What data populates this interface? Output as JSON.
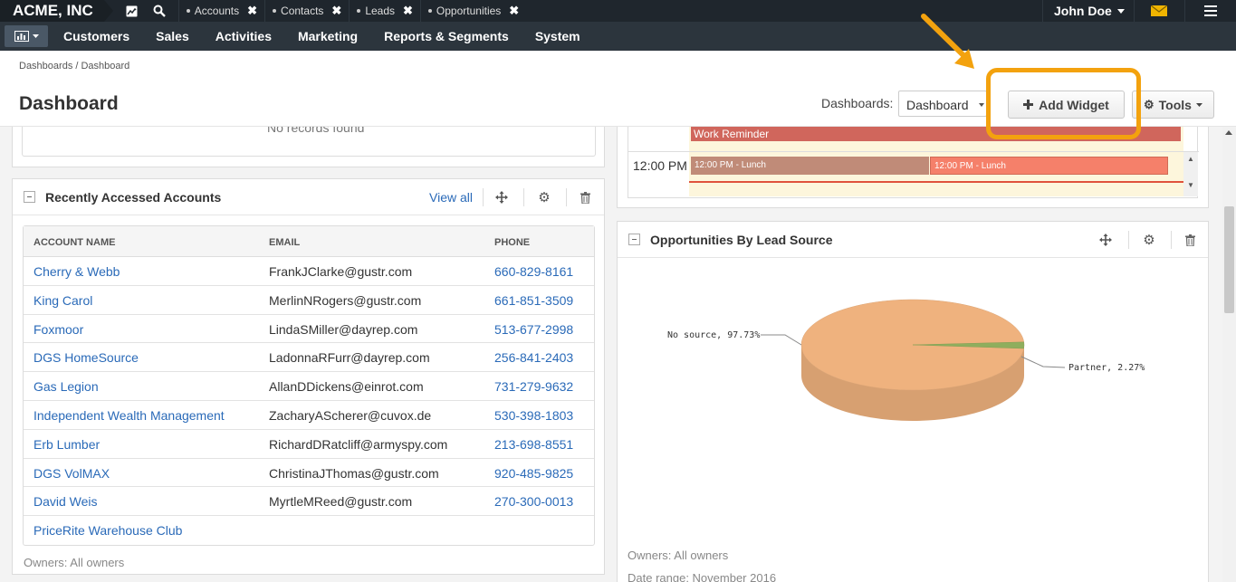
{
  "topbar": {
    "brand": "ACME, INC",
    "pinned_tabs": [
      "Accounts",
      "Contacts",
      "Leads",
      "Opportunities"
    ],
    "user": "John Doe"
  },
  "nav": {
    "items": [
      "Customers",
      "Sales",
      "Activities",
      "Marketing",
      "Reports & Segments",
      "System"
    ]
  },
  "breadcrumb": "Dashboards / Dashboard",
  "header": {
    "title": "Dashboard",
    "dashboards_label": "Dashboards:",
    "dashboard_select": "Dashboard",
    "add_widget": "Add Widget",
    "tools": "Tools"
  },
  "top_widget": {
    "no_records": "No records found"
  },
  "accounts_widget": {
    "title": "Recently Accessed Accounts",
    "view_all": "View all",
    "columns": [
      "ACCOUNT NAME",
      "EMAIL",
      "PHONE"
    ],
    "rows": [
      {
        "name": "Cherry & Webb",
        "email": "FrankJClarke@gustr.com",
        "phone": "660-829-8161"
      },
      {
        "name": "King Carol",
        "email": "MerlinNRogers@gustr.com",
        "phone": "661-851-3509"
      },
      {
        "name": "Foxmoor",
        "email": "LindaSMiller@dayrep.com",
        "phone": "513-677-2998"
      },
      {
        "name": "DGS HomeSource",
        "email": "LadonnaRFurr@dayrep.com",
        "phone": "256-841-2403"
      },
      {
        "name": "Gas Legion",
        "email": "AllanDDickens@einrot.com",
        "phone": "731-279-9632"
      },
      {
        "name": "Independent Wealth Management",
        "email": "ZacharyAScherer@cuvox.de",
        "phone": "530-398-1803"
      },
      {
        "name": "Erb Lumber",
        "email": "RichardDRatcliff@armyspy.com",
        "phone": "213-698-8551"
      },
      {
        "name": "DGS VolMAX",
        "email": "ChristinaJThomas@gustr.com",
        "phone": "920-485-9825"
      },
      {
        "name": "David Weis",
        "email": "MyrtleMReed@gustr.com",
        "phone": "270-300-0013"
      },
      {
        "name": "PriceRite Warehouse Club",
        "email": "",
        "phone": ""
      }
    ],
    "owners": "Owners: All owners"
  },
  "calendar_widget": {
    "event_work": "Work Reminder",
    "time": "12:00 PM",
    "lunch_1": "12:00 PM - Lunch",
    "lunch_2": "12:00 PM - Lunch"
  },
  "opportunities_widget": {
    "title": "Opportunities By Lead Source",
    "owners": "Owners: All owners",
    "date_range": "Date range: November 2016"
  },
  "chart_data": {
    "type": "pie",
    "slices": [
      {
        "label": "No source, 97.73%",
        "value": 97.73,
        "color": "#efb27e"
      },
      {
        "label": "Partner, 2.27%",
        "value": 2.27,
        "color": "#8fae5d"
      }
    ]
  },
  "colors": {
    "topbar": "#1f262d",
    "navbar": "#2c353d",
    "link": "#2a6ab8",
    "highlight": "#f3a20e"
  }
}
